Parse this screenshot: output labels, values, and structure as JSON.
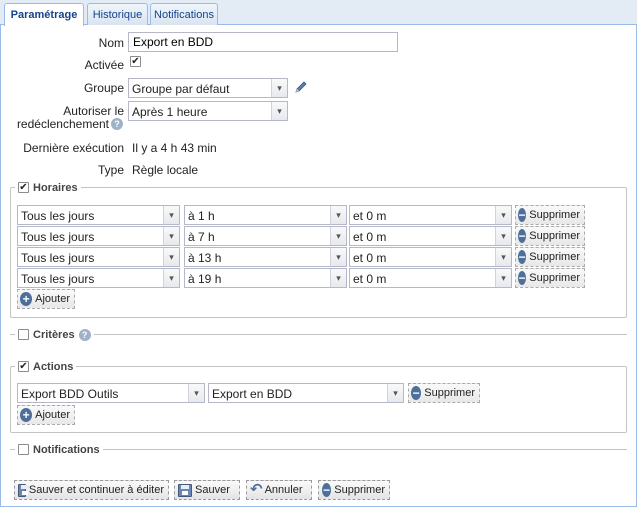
{
  "tabs": [
    {
      "label": "Paramétrage",
      "active": true
    },
    {
      "label": "Historique",
      "active": false
    },
    {
      "label": "Notifications",
      "active": false
    }
  ],
  "form": {
    "nom_label": "Nom",
    "nom_value": "Export en BDD",
    "activee_label": "Activée",
    "activee_checked": true,
    "groupe_label": "Groupe",
    "groupe_value": "Groupe par défaut",
    "autoriser_label_line1": "Autoriser le",
    "autoriser_label_line2": "redéclenchement",
    "autoriser_value": "Après 1 heure",
    "derniere_label": "Dernière exécution",
    "derniere_value": "Il y a 4 h 43 min",
    "type_label": "Type",
    "type_value": "Règle locale"
  },
  "horaires": {
    "legend": "Horaires",
    "checked": true,
    "rows": [
      {
        "jour": "Tous les jours",
        "heure": "à 1 h",
        "minute": "et 0 m"
      },
      {
        "jour": "Tous les jours",
        "heure": "à 7 h",
        "minute": "et 0 m"
      },
      {
        "jour": "Tous les jours",
        "heure": "à 13 h",
        "minute": "et 0 m"
      },
      {
        "jour": "Tous les jours",
        "heure": "à 19 h",
        "minute": "et 0 m"
      }
    ],
    "delete_label": "Supprimer",
    "add_label": "Ajouter"
  },
  "criteres": {
    "legend": "Critères",
    "checked": false
  },
  "actions": {
    "legend": "Actions",
    "checked": true,
    "rows": [
      {
        "type": "Export BDD Outils",
        "cible": "Export en BDD"
      }
    ],
    "delete_label": "Supprimer",
    "add_label": "Ajouter"
  },
  "notifications": {
    "legend": "Notifications",
    "checked": false
  },
  "footer": {
    "save_continue": "Sauver et continuer à éditer",
    "save": "Sauver",
    "cancel": "Annuler",
    "delete": "Supprimer"
  },
  "icons": {
    "check": "✔",
    "chevron": "▾",
    "minus": "−",
    "plus": "+",
    "help": "?",
    "pencil": "pencil-icon",
    "undo": "↶"
  },
  "colors": {
    "tab_text": "#15428b",
    "tab_border": "#99bbe8",
    "icon_blue": "#4f6f9b"
  }
}
